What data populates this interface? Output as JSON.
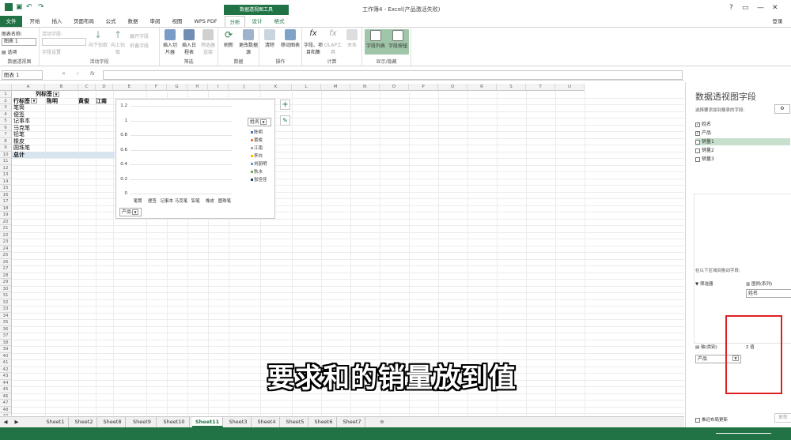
{
  "window": {
    "title": "工作簿4 - Excel(产品激活失败)",
    "context_tab_group": "数据透视图工具",
    "login": "登录",
    "help": "?",
    "restore": "▭",
    "minimize": "—",
    "close": "✕"
  },
  "tabs": {
    "file": "文件",
    "start": "开始",
    "insert": "插入",
    "layout": "页面布局",
    "formula": "公式",
    "data": "数据",
    "review": "审阅",
    "view": "视图",
    "wps": "WPS PDF",
    "analyze": "分析",
    "design": "设计",
    "format": "格式"
  },
  "ribbon": {
    "g1": {
      "name_label": "图表名称:",
      "name_value": "图表 1",
      "options": "选项",
      "label": "数据透视图"
    },
    "g2": {
      "active_field": "活动字段:",
      "field_settings": "字段设置",
      "drill_down": "向下钻取",
      "drill_up": "向上钻取",
      "expand": "展开字段",
      "collapse": "折叠字段",
      "label": "活动字段"
    },
    "g3": {
      "slicer": "插入切片器",
      "timeline": "插入日程表",
      "filter_conn": "筛选器连接",
      "label": "筛选"
    },
    "g4": {
      "refresh": "刷新",
      "change_source": "更改数据源",
      "label": "数据"
    },
    "g5": {
      "clear": "清除",
      "move": "移动图表",
      "label": "操作"
    },
    "g6": {
      "fields_items": "字段、项目和集",
      "olap": "OLAP工具",
      "relations": "关系",
      "label": "计算"
    },
    "g7": {
      "field_list": "字段列表",
      "field_buttons": "字段按钮",
      "label": "显示/隐藏"
    }
  },
  "formula_bar": {
    "name_box": "图表 1",
    "cancel": "✕",
    "enter": "✓",
    "fx": "fx"
  },
  "columns": [
    "A",
    "B",
    "C",
    "D",
    "E",
    "F",
    "G",
    "H",
    "I",
    "J",
    "K",
    "L",
    "M",
    "N",
    "O",
    "P",
    "Q",
    "R",
    "S",
    "T",
    "U"
  ],
  "rows": [
    "1",
    "2",
    "3",
    "4",
    "5",
    "6",
    "7",
    "8",
    "9",
    "10",
    "11",
    "12",
    "13",
    "14",
    "15",
    "16",
    "17",
    "18",
    "19",
    "20",
    "21",
    "22",
    "23",
    "24",
    "25",
    "26",
    "27",
    "28",
    "29",
    "30",
    "31",
    "32",
    "33",
    "34",
    "35",
    "36",
    "37",
    "38",
    "39",
    "40",
    "41",
    "42",
    "43",
    "44",
    "45",
    "46",
    "47",
    "48",
    "49"
  ],
  "pivot": {
    "col_label": "列标签",
    "row_label": "行标签",
    "col_names": [
      "陈明",
      "黄俊",
      "江南"
    ],
    "items": [
      "笔筒",
      "便签",
      "记事本",
      "马克笔",
      "铅笔",
      "橡皮",
      "圆珠笔"
    ],
    "total": "总计"
  },
  "chart_data": {
    "type": "bar",
    "categories": [
      "笔筒",
      "便签",
      "记事本",
      "马克笔",
      "铅笔",
      "橡皮",
      "圆珠笔"
    ],
    "series": [
      {
        "name": "陈明",
        "values": []
      },
      {
        "name": "黄俊",
        "values": []
      },
      {
        "name": "江南",
        "values": []
      },
      {
        "name": "李白",
        "values": []
      },
      {
        "name": "刘丽明",
        "values": []
      },
      {
        "name": "秋水",
        "values": []
      },
      {
        "name": "张佳佳",
        "values": []
      }
    ],
    "yticks": [
      "1.2",
      "1",
      "0.8",
      "0.6",
      "0.4",
      "0.2",
      "0"
    ],
    "ylim": [
      0,
      1.2
    ],
    "legend_field": "姓名",
    "axis_field": "产品",
    "grid": true,
    "legend": "right",
    "colors": [
      "#4472c4",
      "#ed7d31",
      "#a5a5a5",
      "#ffc000",
      "#5b9bd5",
      "#70ad47",
      "#264478"
    ]
  },
  "sheets": [
    "Sheet1",
    "Sheet2",
    "Sheet8",
    "Sheet9",
    "Sheet10",
    "Sheet11",
    "Sheet3",
    "Sheet4",
    "Sheet5",
    "Sheet6",
    "Sheet7"
  ],
  "active_sheet": "Sheet11",
  "pane": {
    "title": "数据透视图字段",
    "choose": "选择要添加到报表的字段:",
    "fields": [
      {
        "name": "姓名",
        "checked": true
      },
      {
        "name": "产品",
        "checked": true
      },
      {
        "name": "销量1",
        "checked": false
      },
      {
        "name": "销量2",
        "checked": false
      },
      {
        "name": "销量3",
        "checked": false
      }
    ],
    "drag_hint": "在以下区域间拖动字段:",
    "filter": "筛选器",
    "legend": "图例(系列)",
    "axis": "轴(类别)",
    "values": "值",
    "sigma": "Σ",
    "legend_item": "姓名",
    "axis_item": "产品",
    "defer": "推迟布局更新",
    "update": "更新"
  },
  "subtitle": "要求和的销量放到值",
  "colors": {
    "accent": "#217346",
    "highlight": "#e02020"
  }
}
